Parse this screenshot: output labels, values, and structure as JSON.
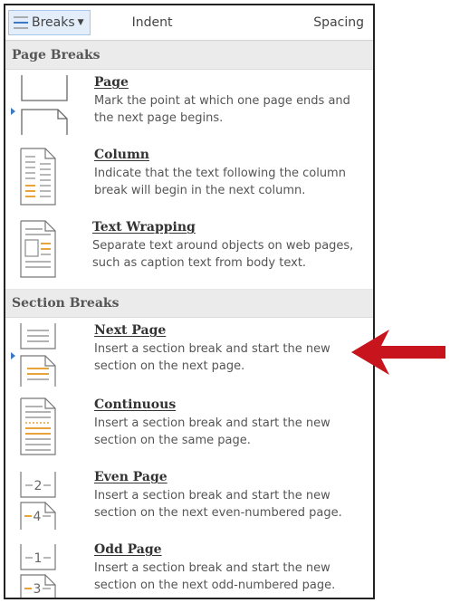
{
  "ribbon": {
    "breaks_label": "Breaks",
    "indent_label": "Indent",
    "spacing_label": "Spacing"
  },
  "page_breaks": {
    "header": "Page Breaks",
    "items": [
      {
        "title": "Page",
        "desc": "Mark the point at which one page ends and the next page begins."
      },
      {
        "title": "Column",
        "desc": "Indicate that the text following the column break will begin in the next column."
      },
      {
        "title": "Text Wrapping",
        "desc": "Separate text around objects on web pages, such as caption text from body text."
      }
    ]
  },
  "section_breaks": {
    "header": "Section Breaks",
    "items": [
      {
        "title": "Next Page",
        "desc": "Insert a section break and start the new section on the next page.",
        "icon_num_top": "",
        "icon_num_bottom": ""
      },
      {
        "title": "Continuous",
        "desc": "Insert a section break and start the new section on the same page.",
        "icon_num_top": "",
        "icon_num_bottom": ""
      },
      {
        "title": "Even Page",
        "desc": "Insert a section break and start the new section on the next even-numbered page.",
        "icon_num_top": "2",
        "icon_num_bottom": "4"
      },
      {
        "title": "Odd Page",
        "desc": "Insert a section break and start the new section on the next odd-numbered page.",
        "icon_num_top": "1",
        "icon_num_bottom": "3"
      }
    ]
  },
  "colors": {
    "accent_blue": "#3c78c4",
    "highlight_orange": "#e8a33c",
    "annotation_arrow": "#c8141c"
  }
}
